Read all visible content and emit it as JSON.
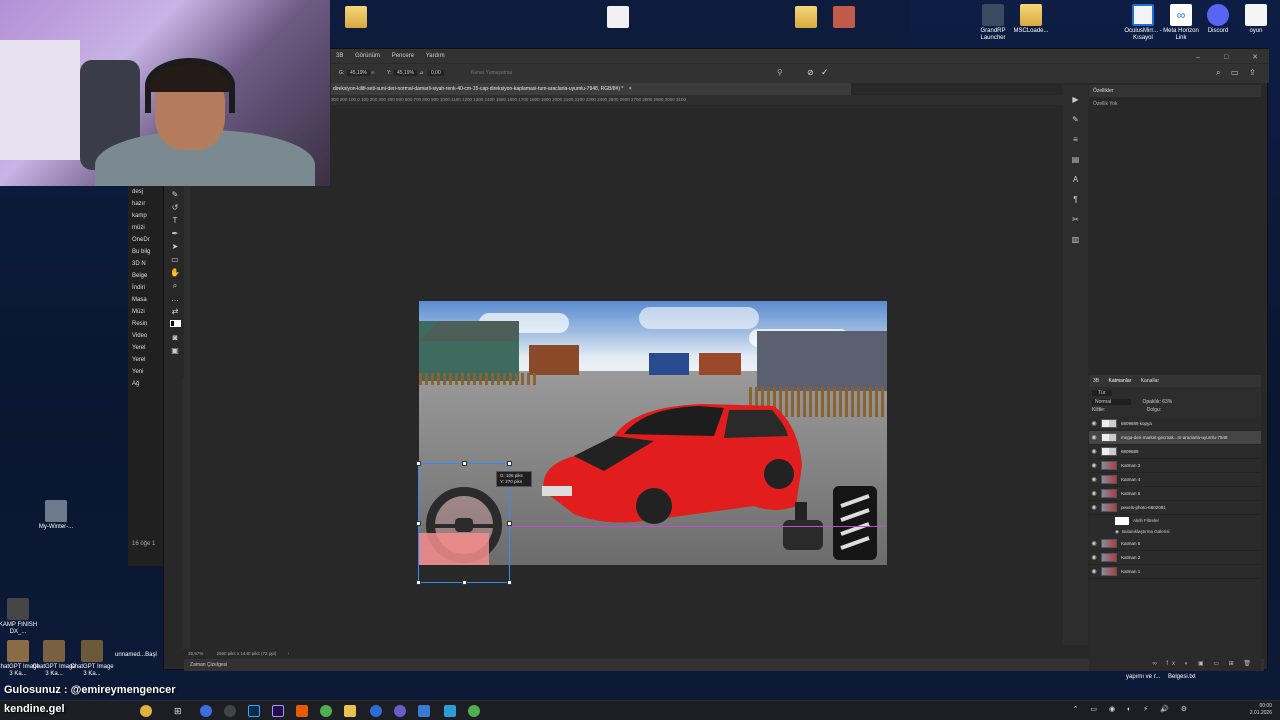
{
  "desktop": {
    "top_icons": [
      {
        "label": "",
        "icon": "folder-icon"
      },
      {
        "label": "",
        "icon": "folder-icon"
      },
      {
        "label": "",
        "icon": "folder-icon"
      },
      {
        "label": "",
        "icon": "folder-icon"
      },
      {
        "label": "GrandRP Launcher",
        "icon": "grandrp-icon"
      },
      {
        "label": "MSCLoade...",
        "icon": "folder-icon"
      },
      {
        "label": "OculusMirr... - Kısayol",
        "icon": "oculus-icon"
      },
      {
        "label": "Meta Horizon Link",
        "icon": "meta-icon"
      },
      {
        "label": "Discord",
        "icon": "discord-icon"
      },
      {
        "label": "oyun",
        "icon": "folder-icon"
      }
    ],
    "left_icons": [
      {
        "label": "My-Winter-...",
        "icon": "app-icon"
      },
      {
        "label": "KAMP FINISH DX_...",
        "icon": "image-icon"
      }
    ],
    "bottom_icons": [
      {
        "label": "ChatGPT Image 3 Ka...",
        "icon": "image-icon"
      },
      {
        "label": "ChatGPT Image 3 Ka...",
        "icon": "image-icon"
      },
      {
        "label": "ChatGPT Image 3 Ka...",
        "icon": "image-icon"
      },
      {
        "label": "unnamed...",
        "icon": "image-icon"
      },
      {
        "label": "Başl",
        "icon": "image-icon"
      }
    ],
    "bottom_right_icons": [
      {
        "label": "yapımı ve r...",
        "icon": "file-icon"
      },
      {
        "label": "Belgesi.txt",
        "icon": "file-icon"
      }
    ]
  },
  "explorer": {
    "items": [
      "desj",
      "hazır",
      "kamp",
      "müzi",
      "OneDr",
      "Bu bilg",
      "3D N",
      "Belge",
      "İndiri",
      "Masa",
      "Müzi",
      "Resin",
      "Video",
      "Yerel",
      "Yerel",
      "Yeni",
      "Ağ"
    ],
    "status": "16 öğe  1"
  },
  "photoshop": {
    "menu": [
      "3B",
      "Görünüm",
      "Pencere",
      "Yardım"
    ],
    "options": {
      "w_label": "G:",
      "w_value": "45,19%",
      "h_label": "Y:",
      "h_value": "45,19%",
      "angle_label": "⊿",
      "angle_value": "0,00",
      "interp_label": "Kenar Yumuşatma"
    },
    "doc_tab": "direksiyon-kilifi-seti-suni-deri-normal-damarli-siyah-renk-40-cm-15-cap-direksiyon-kaplamasi-tum-araclarla-uyumlu-7948, RGB/8#) *",
    "ruler_ticks": "300  200  100  0    100  200  300  400  500  600  700  800  900  1000  1100  1200  1300  1400  1500  1600  1700  1800  1900  2000  2100  2200  2300  2400  2500  2600  2700  2800  2900  3000  3100",
    "transform_tip": {
      "line1": "G: 106 piks",
      "line2": "Y: 270 piks"
    },
    "status_zoom": "36,67%",
    "status_size": "2560 piks x 1440 piks (72 ppi)",
    "timeline_label": "Zaman Çizelgesi",
    "panels": {
      "properties_title": "Özellikler",
      "properties_empty": "Özellik Yok",
      "layers_tabs": [
        "3B",
        "Katmanlar",
        "Kanallar"
      ],
      "filter_placeholder": "Tür",
      "blend_mode": "Normal",
      "opacity_label": "Opaklık:",
      "opacity_value": "63%",
      "lock_label": "Kilitle:",
      "fill_label": "Dolgu:",
      "fill_value": "",
      "layers": [
        {
          "name": "6809689 kopya",
          "thumb": "transparent"
        },
        {
          "name": "mega-deri-market-gecmak...m-araclarla-uyumlu-7948",
          "thumb": "transparent",
          "selected": true
        },
        {
          "name": "6809689",
          "thumb": "transparent"
        },
        {
          "name": "Katman 3",
          "thumb": "pic"
        },
        {
          "name": "Katman 4",
          "thumb": "pic"
        },
        {
          "name": "Katman 6",
          "thumb": "pic"
        },
        {
          "name": "pexels-photo-6602081",
          "thumb": "pic"
        },
        {
          "name": "Akıllı Filtreler",
          "thumb": "filter",
          "sub": true
        },
        {
          "name": "Bulanıklaştırma Galerisi",
          "thumb": "none",
          "sub": true
        },
        {
          "name": "Katman 5",
          "thumb": "pic"
        },
        {
          "name": "Katman 2",
          "thumb": "pic"
        },
        {
          "name": "Katman 1",
          "thumb": "pic"
        }
      ]
    }
  },
  "stream_overlay": {
    "line1": "Gulosunuz : @emireymengencer",
    "line2": "kendine.gel"
  },
  "taskbar": {
    "clock_time": "00:00",
    "clock_date": "2.01.2026"
  }
}
